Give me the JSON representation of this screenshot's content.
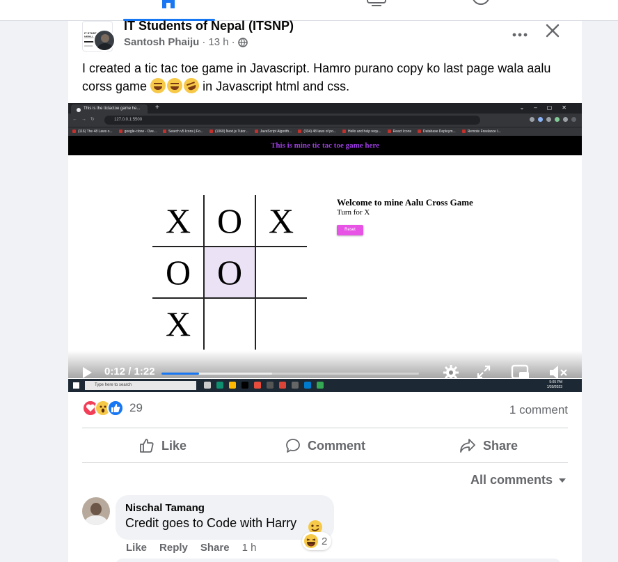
{
  "post": {
    "group_name": "IT Students of Nepal (ITSNP)",
    "author": "Santosh Phaiju",
    "time": "13 h",
    "sep": "·",
    "text_before": "I created a tic tac toe game in Javascript. Hamro purano copy ko last page wala aalu corss game",
    "text_after": "in Javascript html and css.",
    "emojis": [
      "laughing",
      "joy",
      "rofl"
    ]
  },
  "video": {
    "browser": {
      "tab_title": "This is the tictactoe game he...",
      "address": "127.0.0.1:5500",
      "bookmarks": [
        "(116) The 48 Laws o...",
        "google-clone - Ove...",
        "Search v5 Icons | Fo...",
        "(1060) Next.js Tutor...",
        "JavaScript Algorith...",
        "(334) 48 laws of po...",
        "Hello and help requ...",
        "React Icons",
        "Database Deploym...",
        "Remote Freelance I..."
      ]
    },
    "app_header": "This is mine tic tac toe game here",
    "board": [
      "X",
      "O",
      "X",
      "O",
      "O",
      "",
      "X",
      "",
      ""
    ],
    "highlight_cell": 4,
    "game_title": "Welcome to mine Aalu Cross Game",
    "turn_text": "Turn for X",
    "reset_label": "Reset",
    "current_time": "0:12",
    "duration": "1:22",
    "time_display": "0:12 / 1:22",
    "played_fraction": 0.146,
    "buffered_fraction": 0.43,
    "taskbar": {
      "search_placeholder": "Type here to search",
      "clock_time": "5:05 PM",
      "clock_date": "1/30/2023"
    },
    "colors": {
      "accent": "#1877f2",
      "header_text": "#9b3ce0",
      "reset_bg": "#e754e5",
      "highlight": "#ebe2f5"
    }
  },
  "stats": {
    "reaction_count": "29",
    "reactions": [
      "love",
      "wow",
      "like"
    ],
    "comment_count": "1 comment"
  },
  "actions": {
    "like": "Like",
    "comment": "Comment",
    "share": "Share"
  },
  "comments_filter": "All comments",
  "comment": {
    "author": "Nischal Tamang",
    "text": "Credit goes to Code with Harry",
    "reaction_count": "2",
    "like": "Like",
    "reply": "Reply",
    "share": "Share",
    "time": "1 h"
  }
}
